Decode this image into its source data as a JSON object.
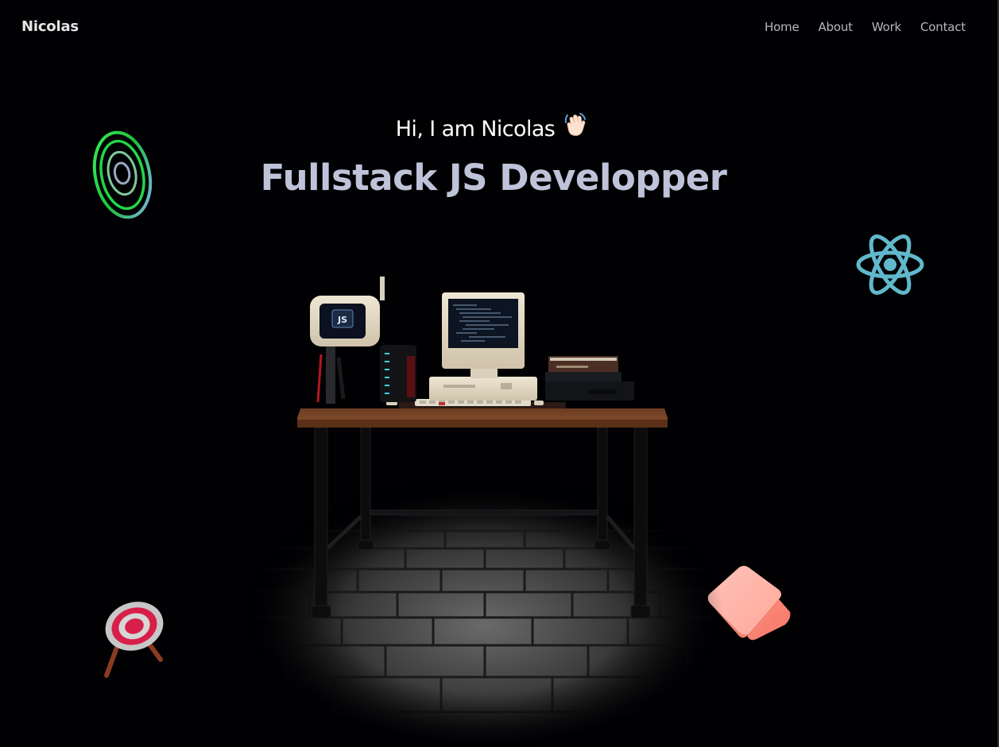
{
  "nav": {
    "brand": "Nicolas",
    "links": [
      {
        "label": "Home"
      },
      {
        "label": "About"
      },
      {
        "label": "Work"
      },
      {
        "label": "Contact"
      }
    ]
  },
  "hero": {
    "greeting": "Hi, I am Nicolas",
    "wave_icon": "waving-hand-icon",
    "title": "Fullstack JS Developper"
  },
  "decorations": {
    "top_left": "rings-icon",
    "top_right": "react-logo-icon",
    "bottom_left": "target-icon",
    "bottom_right": "pink-cube-icon"
  },
  "scene": {
    "name": "desk-computer-scene",
    "monitor_logo": "JS"
  },
  "colors": {
    "background": "#010103",
    "title": "#bfc3d9",
    "nav_link": "#b8b8bc",
    "react": "#61b8cc",
    "rings": "#2ee84a",
    "cube": "#fb8f80",
    "target": "#d81f4a"
  }
}
